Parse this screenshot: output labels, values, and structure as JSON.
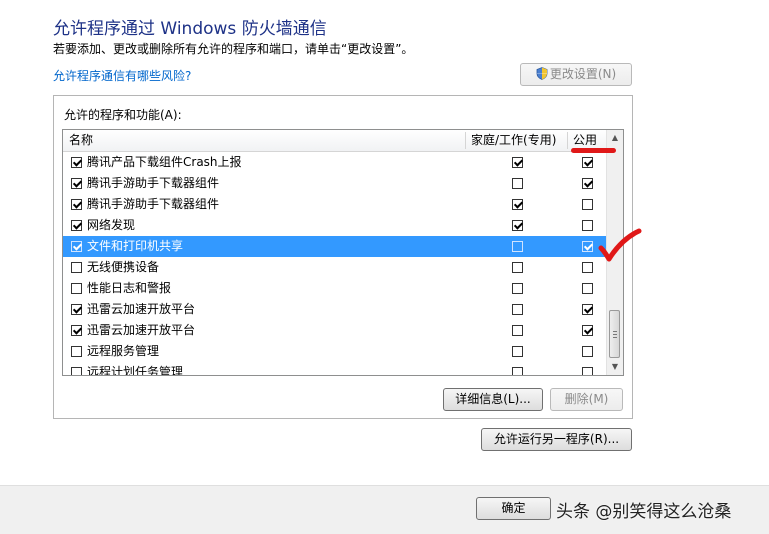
{
  "title": "允许程序通过 Windows 防火墙通信",
  "description": "若要添加、更改或删除所有允许的程序和端口，请单击“更改设置”。",
  "risk_link": "允许程序通信有哪些风险?",
  "change_settings_label": "更改设置(N)",
  "group_label": "允许的程序和功能(A):",
  "columns": {
    "name": "名称",
    "home_work": "家庭/工作(专用)",
    "public": "公用"
  },
  "rows": [
    {
      "name": "腾讯产品下载组件Crash上报",
      "enabled": true,
      "home": true,
      "public": true,
      "selected": false
    },
    {
      "name": "腾讯手游助手下载器组件",
      "enabled": true,
      "home": false,
      "public": true,
      "selected": false
    },
    {
      "name": "腾讯手游助手下载器组件",
      "enabled": true,
      "home": true,
      "public": false,
      "selected": false
    },
    {
      "name": "网络发现",
      "enabled": true,
      "home": true,
      "public": false,
      "selected": false
    },
    {
      "name": "文件和打印机共享",
      "enabled": true,
      "home": false,
      "public": true,
      "selected": true
    },
    {
      "name": "无线便携设备",
      "enabled": false,
      "home": false,
      "public": false,
      "selected": false
    },
    {
      "name": "性能日志和警报",
      "enabled": false,
      "home": false,
      "public": false,
      "selected": false
    },
    {
      "name": "迅雷云加速开放平台",
      "enabled": true,
      "home": false,
      "public": true,
      "selected": false
    },
    {
      "name": "迅雷云加速开放平台",
      "enabled": true,
      "home": false,
      "public": true,
      "selected": false
    },
    {
      "name": "远程服务管理",
      "enabled": false,
      "home": false,
      "public": false,
      "selected": false
    },
    {
      "name": "远程计划任务管理",
      "enabled": false,
      "home": false,
      "public": false,
      "selected": false
    }
  ],
  "details_label": "详细信息(L)...",
  "delete_label": "删除(M)",
  "allow_another_label": "允许运行另一程序(R)...",
  "ok_label": "确定",
  "watermark": "头条 @别笑得这么沧桑",
  "accent_color": "#3399ff",
  "annotation_color": "#e01818"
}
